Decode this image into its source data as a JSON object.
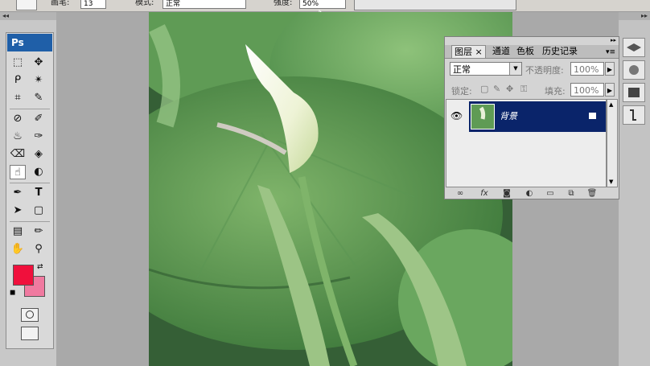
{
  "options_bar": {
    "size_value": "13",
    "mode_label": "模式:",
    "mode_value": "正常",
    "opacity_label": "强度:",
    "opacity_value": "50%"
  },
  "toolbox": {
    "logo": "Ps",
    "tools": [
      "rect-marquee",
      "move",
      "lasso",
      "magic-wand",
      "crop",
      "slice",
      "healing",
      "brush",
      "stamp",
      "history-brush",
      "eraser",
      "paint-bucket",
      "smudge",
      "dodge",
      "pen",
      "type",
      "path-select",
      "shape",
      "notes",
      "eyedropper",
      "hand",
      "zoom"
    ],
    "foreground_color": "#f0103c",
    "background_color": "#f07aa0"
  },
  "layers_panel": {
    "tabs": [
      "图层",
      "通道",
      "色板",
      "历史记录"
    ],
    "close_glyph": "×",
    "blend_mode": "正常",
    "opacity_label": "不透明度:",
    "opacity_value": "100%",
    "lock_label": "锁定:",
    "fill_label": "填充:",
    "fill_value": "100%",
    "layer_name": "背景"
  },
  "colors": {
    "selection": "#0a246a",
    "ps_blue": "#1f5fa8"
  }
}
